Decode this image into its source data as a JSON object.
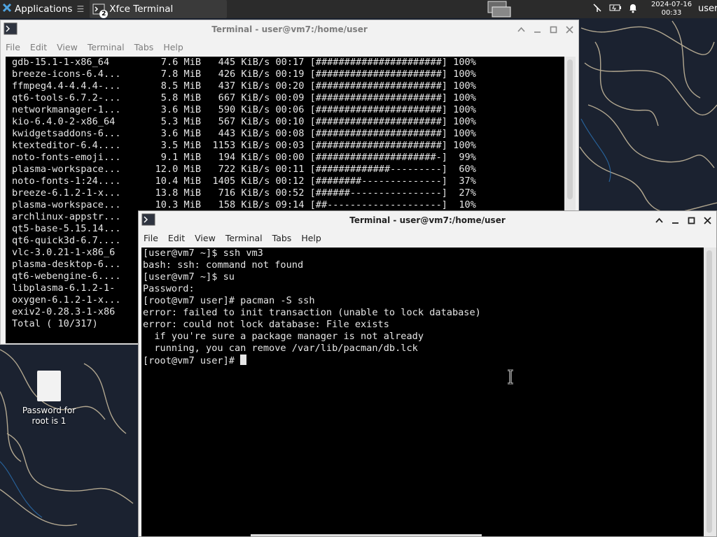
{
  "panel": {
    "applications_label": "Applications",
    "applications_sep": "☰",
    "task_label": "Xfce Terminal",
    "task_badge": "2",
    "clock_date": "2024-07-16",
    "clock_time": "00:33",
    "user": "user"
  },
  "desktop": {
    "file_label": "Password for root is 1"
  },
  "window_bg": {
    "title": "Terminal - user@vm7:/home/user",
    "menu": [
      "File",
      "Edit",
      "View",
      "Terminal",
      "Tabs",
      "Help"
    ],
    "lines": [
      "gdb-15.1-1-x86_64         7.6 MiB   445 KiB/s 00:17 [######################] 100%",
      "breeze-icons-6.4...       7.8 MiB   426 KiB/s 00:19 [######################] 100%",
      "ffmpeg4.4-4.4.4-...       8.5 MiB   437 KiB/s 00:20 [######################] 100%",
      "qt6-tools-6.7.2-...       5.8 MiB   667 KiB/s 00:09 [######################] 100%",
      "networkmanager-1...       3.6 MiB   590 KiB/s 00:06 [######################] 100%",
      "kio-6.4.0-2-x86_64        5.3 MiB   567 KiB/s 00:10 [######################] 100%",
      "kwidgetsaddons-6...       3.6 MiB   443 KiB/s 00:08 [######################] 100%",
      "ktexteditor-6.4....       3.5 MiB  1153 KiB/s 00:03 [######################] 100%",
      "noto-fonts-emoji...       9.1 MiB   194 KiB/s 00:00 [#####################-]  99%",
      "plasma-workspace...      12.0 MiB   722 KiB/s 00:11 [#############---------]  60%",
      "noto-fonts-1:24....      10.4 MiB  1405 KiB/s 00:12 [########--------------]  37%",
      "breeze-6.1.2-1-x...      13.8 MiB   716 KiB/s 00:52 [######----------------]  27%",
      "plasma-workspace...      10.3 MiB   158 KiB/s 09:14 [##--------------------]  10%",
      "archlinux-appstr...",
      "qt5-base-5.15.14...",
      "qt6-quick3d-6.7....",
      "vlc-3.0.21-1-x86_6",
      "plasma-desktop-6...",
      "qt6-webengine-6....",
      "libplasma-6.1.2-1-",
      "oxygen-6.1.2-1-x...",
      "exiv2-0.28.3-1-x86",
      "Total ( 10/317)"
    ]
  },
  "window_fg": {
    "title": "Terminal - user@vm7:/home/user",
    "menu": [
      "File",
      "Edit",
      "View",
      "Terminal",
      "Tabs",
      "Help"
    ],
    "lines": [
      "[user@vm7 ~]$ ssh vm3",
      "bash: ssh: command not found",
      "[user@vm7 ~]$ su",
      "Password:",
      "[root@vm7 user]# pacman -S ssh",
      "error: failed to init transaction (unable to lock database)",
      "error: could not lock database: File exists",
      "  if you're sure a package manager is not already",
      "  running, you can remove /var/lib/pacman/db.lck"
    ],
    "prompt": "[root@vm7 user]# "
  },
  "colors": {
    "panel_bg": "#2b2b2b",
    "terminal_bg": "#000000",
    "terminal_fg": "#e6e6e6",
    "window_bg": "#f2f2f2"
  }
}
